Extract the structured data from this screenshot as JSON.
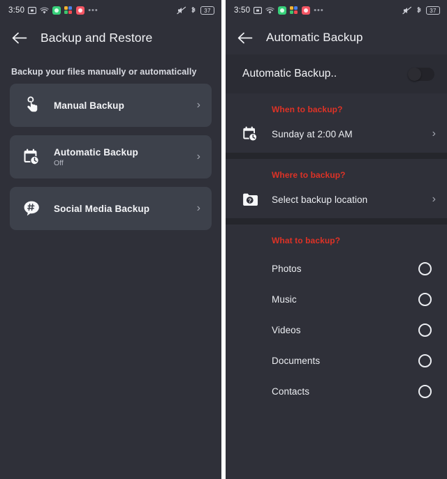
{
  "status_bar": {
    "clock": "3:50",
    "icons": [
      "screenshot-icon",
      "wifi-icon",
      "app-green-icon",
      "app-dots-icon",
      "app-red-icon",
      "overflow-ellipsis-icon"
    ],
    "overflow": "•••",
    "mute_icon": "volume-mute-icon",
    "bluetooth_icon": "bluetooth-icon",
    "battery_level": "37"
  },
  "left_screen": {
    "back_icon": "arrow-back-icon",
    "title": "Backup and Restore",
    "subtitle": "Backup your files manually or automatically",
    "cards": [
      {
        "icon": "tap-gesture-icon",
        "title": "Manual Backup",
        "sub": "",
        "chevron": "›"
      },
      {
        "icon": "calendar-clock-icon",
        "title": "Automatic Backup",
        "sub": "Off",
        "chevron": "›"
      },
      {
        "icon": "hashtag-bubble-icon",
        "title": "Social Media Backup",
        "sub": "",
        "chevron": "›"
      }
    ]
  },
  "right_screen": {
    "back_icon": "arrow-back-icon",
    "title": "Automatic Backup",
    "toggle": {
      "label": "Automatic Backup..",
      "state": "off"
    },
    "sections": [
      {
        "heading": "When to backup?",
        "row": {
          "icon": "calendar-clock-icon",
          "label": "Sunday at 2:00 AM",
          "chevron": "›"
        }
      },
      {
        "heading": "Where to backup?",
        "row": {
          "icon": "folder-question-icon",
          "label": "Select backup location",
          "chevron": "›"
        }
      }
    ],
    "what_heading": "What to backup?",
    "what_items": [
      {
        "label": "Photos",
        "checked": false
      },
      {
        "label": "Music",
        "checked": false
      },
      {
        "label": "Videos",
        "checked": false
      },
      {
        "label": "Documents",
        "checked": false
      },
      {
        "label": "Contacts",
        "checked": false
      }
    ]
  },
  "colors": {
    "background": "#2f3039",
    "card": "#3d414b",
    "accent_red": "#de3226",
    "text_primary": "#f2f3f6",
    "text_secondary": "#b9bcc6",
    "divider": "#25262c"
  }
}
